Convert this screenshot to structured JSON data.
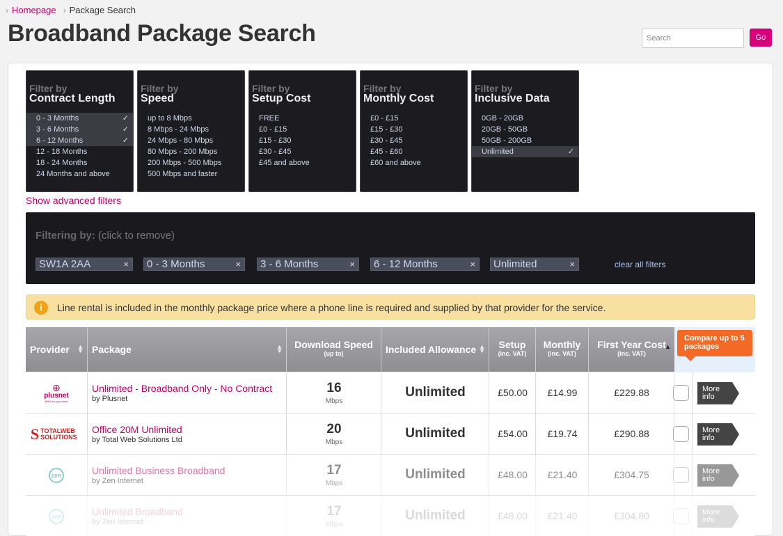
{
  "breadcrumb": {
    "home": "Homepage",
    "current": "Package Search"
  },
  "page_title": "Broadband Package Search",
  "search": {
    "placeholder": "Search",
    "button": "Go"
  },
  "filters": [
    {
      "by": "Filter by",
      "name": "Contract Length",
      "options": [
        "0 - 3 Months",
        "3 - 6 Months",
        "6 - 12 Months",
        "12 - 18 Months",
        "18 - 24 Months",
        "24 Months and above"
      ],
      "selected": [
        true,
        true,
        true,
        false,
        false,
        false
      ]
    },
    {
      "by": "Filter by",
      "name": "Speed",
      "options": [
        "up to 8 Mbps",
        "8 Mbps - 24 Mbps",
        "24 Mbps - 80 Mbps",
        "80 Mbps - 200 Mbps",
        "200 Mbps - 500 Mbps",
        "500 Mbps and faster"
      ],
      "selected": [
        false,
        false,
        false,
        false,
        false,
        false
      ]
    },
    {
      "by": "Filter by",
      "name": "Setup Cost",
      "options": [
        "FREE",
        "£0 - £15",
        "£15 - £30",
        "£30 - £45",
        "£45 and above"
      ],
      "selected": [
        false,
        false,
        false,
        false,
        false
      ]
    },
    {
      "by": "Filter by",
      "name": "Monthly Cost",
      "options": [
        "£0 - £15",
        "£15 - £30",
        "£30 - £45",
        "£45 - £60",
        "£60 and above"
      ],
      "selected": [
        false,
        false,
        false,
        false,
        false
      ]
    },
    {
      "by": "Filter by",
      "name": "Inclusive Data",
      "options": [
        "0GB - 20GB",
        "20GB - 50GB",
        "50GB - 200GB",
        "Unlimited"
      ],
      "selected": [
        false,
        false,
        false,
        true
      ]
    }
  ],
  "advanced_link": "Show advanced filters",
  "filtering": {
    "label": "Filtering by:",
    "hint": "(click to remove)",
    "tags": [
      "SW1A 2AA",
      "0 - 3 Months",
      "3 - 6 Months",
      "6 - 12 Months",
      "Unlimited"
    ],
    "remove_glyph": "×",
    "clear": "clear all filters"
  },
  "notice": {
    "icon": "i",
    "text": "Line rental is included in the monthly package price where a phone line is required and supplied by that provider for the service."
  },
  "table": {
    "headers": {
      "provider": "Provider",
      "package": "Package",
      "speed": "Download Speed",
      "speed_sub": "(up to)",
      "allowance": "Included Allowance",
      "setup": "Setup",
      "setup_sub": "(inc. VAT)",
      "monthly": "Monthly",
      "monthly_sub": "(inc. VAT)",
      "first_year": "First Year Cost",
      "first_year_sub": "(inc. VAT)",
      "compare": "Compare up to 5 packages"
    },
    "rows": [
      {
        "logo": "plusnet",
        "logo_sub": "We'll do you proud",
        "name": "Unlimited - Broadband Only - No Contract",
        "by": "by Plusnet",
        "speed": "16",
        "unit": "Mbps",
        "allowance": "Unlimited",
        "setup": "£50.00",
        "monthly": "£14.99",
        "first_year": "£229.88",
        "more": "More info"
      },
      {
        "logo": "TOTALWEB SOLUTIONS",
        "name": "Office 20M Unlimited",
        "by": "by Total Web Solutions Ltd",
        "speed": "20",
        "unit": "Mbps",
        "allowance": "Unlimited",
        "setup": "£54.00",
        "monthly": "£19.74",
        "first_year": "£290.88",
        "more": "More info"
      },
      {
        "logo": "zen",
        "name": "Unlimited Business Broadband",
        "by": "by Zen Internet",
        "speed": "17",
        "unit": "Mbps",
        "allowance": "Unlimited",
        "setup": "£48.00",
        "monthly": "£21.40",
        "first_year": "£304.75",
        "more": "More info"
      },
      {
        "logo": "zen",
        "name": "Unlimited Broadband",
        "by": "by Zen Internet",
        "speed": "17",
        "unit": "Mbps",
        "allowance": "Unlimited",
        "setup": "£48.00",
        "monthly": "£21.40",
        "first_year": "£304.80",
        "more": "More info"
      }
    ]
  },
  "colors": {
    "accent": "#d6007a",
    "link": "#c2006a",
    "compare": "#f26a25",
    "notice_bg": "#f8e0a0"
  }
}
